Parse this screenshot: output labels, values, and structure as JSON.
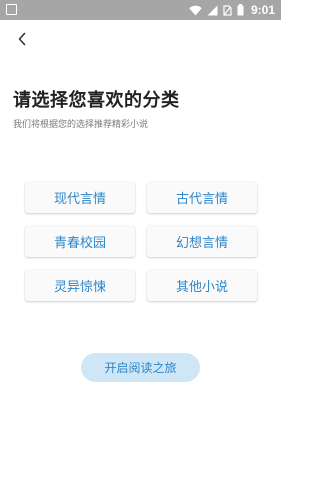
{
  "status_bar": {
    "time": "9:01",
    "icons": [
      "wifi-icon",
      "signal-icon",
      "sim-icon",
      "battery-icon"
    ],
    "background": "#a6a6a6"
  },
  "header": {
    "back_icon": "chevron-left-icon"
  },
  "main": {
    "title": "请选择您喜欢的分类",
    "subtitle": "我们将根据您的选择推荐精彩小说",
    "categories": [
      {
        "label": "现代言情"
      },
      {
        "label": "古代言情"
      },
      {
        "label": "青春校园"
      },
      {
        "label": "幻想言情"
      },
      {
        "label": "灵异惊悚"
      },
      {
        "label": "其他小说"
      }
    ],
    "start_button": "开启阅读之旅"
  },
  "colors": {
    "accent": "#2f86c9",
    "start_button_bg": "#cfe6f6",
    "title": "#222222",
    "subtitle": "#7a7a7a"
  }
}
